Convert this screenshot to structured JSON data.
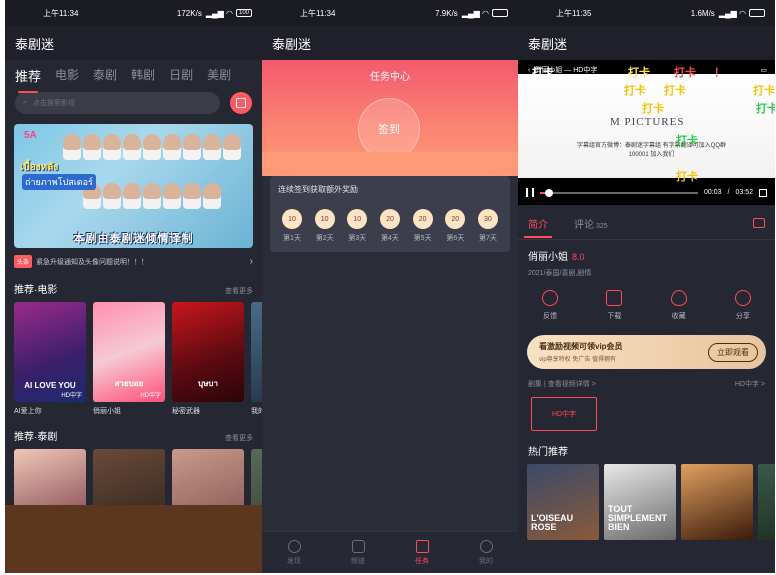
{
  "screen1": {
    "status": {
      "time": "上午11:34",
      "net": "172K/s",
      "battery": "100"
    },
    "appbar_title": "泰剧迷",
    "tabs": [
      "推荐",
      "电影",
      "泰剧",
      "韩剧",
      "日剧",
      "美剧"
    ],
    "search_placeholder": "点击搜索影视",
    "banner": {
      "logo": "5A",
      "thai_line1": "เบื้องหลัง",
      "thai_line2": "ถ่ายภาพโปสเตอร์",
      "caption": "本剧由泰剧迷倾情译制"
    },
    "notice": {
      "tag": "头条",
      "text": "紧急升级通知及头像问题说明！！！"
    },
    "section_movies": {
      "title": "推荐·电影",
      "more": "查看更多"
    },
    "movies": [
      {
        "title": "AI爱上你",
        "poster_text": "AI LOVE YOU",
        "badge": "HD中字"
      },
      {
        "title": "俏丽小姐",
        "poster_text": "สวยบอย",
        "badge": "HD中字"
      },
      {
        "title": "秘密武器",
        "poster_text": "บุษบา",
        "badge": ""
      },
      {
        "title": "我的",
        "poster_text": "",
        "badge": ""
      }
    ],
    "section_dramas": {
      "title": "推荐·泰剧",
      "more": "查看更多"
    }
  },
  "screen2": {
    "status": {
      "time": "上午11:34",
      "net": "7.9K/s"
    },
    "appbar_title": "泰剧迷",
    "task_title": "任务中心",
    "checkin_label": "签到",
    "sign_label": "连续签到获取额外奖励",
    "days": [
      {
        "coin": "10",
        "label": "第1天"
      },
      {
        "coin": "10",
        "label": "第2天"
      },
      {
        "coin": "10",
        "label": "第3天"
      },
      {
        "coin": "20",
        "label": "第4天"
      },
      {
        "coin": "20",
        "label": "第5天"
      },
      {
        "coin": "20",
        "label": "第6天"
      },
      {
        "coin": "30",
        "label": "第7天"
      }
    ],
    "nav": [
      {
        "label": "发现",
        "icon": "compass-icon"
      },
      {
        "label": "频道",
        "icon": "play-icon"
      },
      {
        "label": "任务",
        "icon": "task-icon"
      },
      {
        "label": "我的",
        "icon": "user-icon"
      }
    ]
  },
  "screen3": {
    "status": {
      "time": "上午11:35",
      "net": "1.6M/s"
    },
    "appbar_title": "泰剧迷",
    "player": {
      "title": "俏丽小姐 — HD中字",
      "watermark": "M PICTURES",
      "subtitle1": "字幕组官方微博：泰剧迷字幕组   有字幕翻译可加入QQ群",
      "subtitle2": "100001 加入我们",
      "current_time": "00:03",
      "duration": "03:52",
      "progress": 0.06,
      "danmaku": [
        "打卡",
        "打卡",
        "打卡",
        "！",
        "打卡",
        "打卡",
        "打卡",
        "打卡",
        "打卡",
        "打卡",
        "打卡",
        "打卡"
      ]
    },
    "detail_tabs": {
      "intro": "简介",
      "comments": "评论",
      "comment_count": "325"
    },
    "name": "俏丽小姐",
    "score": "8.0",
    "meta": "2021/泰国/喜剧,剧情",
    "actions": [
      {
        "label": "反馈",
        "icon": "feedback-icon"
      },
      {
        "label": "下载",
        "icon": "download-icon"
      },
      {
        "label": "收藏",
        "icon": "heart-icon"
      },
      {
        "label": "分享",
        "icon": "share-icon"
      }
    ],
    "vip": {
      "title": "看激励视频可领vip会员",
      "subtitle": "vip尊享特权 免广告 值得拥有",
      "button": "立即观看"
    },
    "episodes": {
      "label": "剧集 | 查看视频详情 >",
      "quality": "HD中字 >",
      "item": "HD中字"
    },
    "hot_title": "热门推荐",
    "hot": [
      {
        "text": "L'OISEAU ROSE"
      },
      {
        "text": "TOUT SIMPLEMENT BIEN"
      },
      {
        "text": ""
      },
      {
        "text": ""
      }
    ]
  }
}
